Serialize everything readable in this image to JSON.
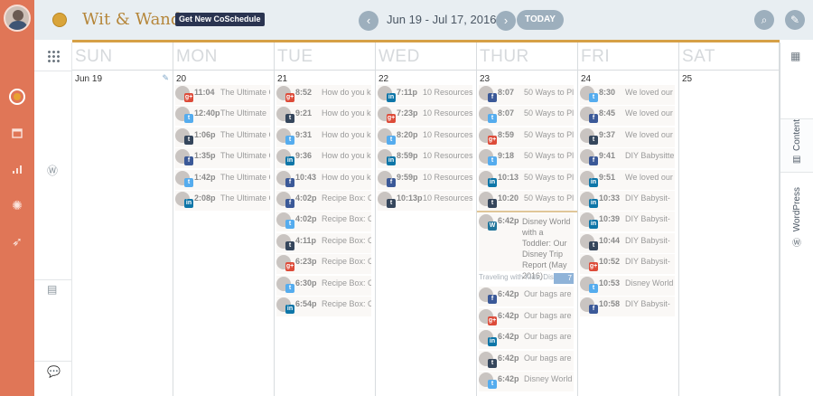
{
  "app": {
    "title": "Wit & Wander",
    "promo": "Get New CoSchedule",
    "range": "Jun 19 - Jul 17, 2016 ▾",
    "today": "TODAY"
  },
  "colors": {
    "rail": "#e07657",
    "accent": "#d6a046",
    "header_bg": "#e8eef2",
    "twitter": "#55acee",
    "facebook": "#3b5998",
    "linkedin": "#0e76a8",
    "googleplus": "#dd4b39",
    "tumblr": "#35465c",
    "wordpress": "#21759b"
  },
  "rail": {
    "icons": [
      "avatar",
      "circle-icon",
      "calendar-icon",
      "bar-chart-icon",
      "gear-icon",
      "rocket-icon"
    ]
  },
  "right_panel": {
    "tabs": [
      {
        "label": "Content",
        "icon": "document-icon"
      },
      {
        "label": "WordPress",
        "icon": "wordpress-icon"
      }
    ]
  },
  "days": [
    {
      "name": "SUN",
      "date": "Jun 19",
      "events": []
    },
    {
      "name": "MON",
      "date": "20",
      "events": [
        {
          "time": "11:04",
          "text": "The Ultimate G",
          "net": "googleplus"
        },
        {
          "time": "12:40p",
          "text": "The Ultimate",
          "net": "twitter"
        },
        {
          "time": "1:06p",
          "text": "The Ultimate G",
          "net": "tumblr"
        },
        {
          "time": "1:35p",
          "text": "The Ultimate G",
          "net": "facebook"
        },
        {
          "time": "1:42p",
          "text": "The Ultimate G",
          "net": "twitter"
        },
        {
          "time": "2:08p",
          "text": "The Ultimate G",
          "net": "linkedin"
        }
      ]
    },
    {
      "name": "TUE",
      "date": "21",
      "events": [
        {
          "time": "8:52",
          "text": "How do you kee",
          "net": "googleplus"
        },
        {
          "time": "9:21",
          "text": "How do you kee",
          "net": "tumblr"
        },
        {
          "time": "9:31",
          "text": "How do you kee",
          "net": "twitter"
        },
        {
          "time": "9:36",
          "text": "How do you kee",
          "net": "linkedin"
        },
        {
          "time": "10:43",
          "text": "How do you ke",
          "net": "facebook"
        },
        {
          "time": "4:02p",
          "text": "Recipe Box: Cr",
          "net": "facebook"
        },
        {
          "time": "4:02p",
          "text": "Recipe Box: Cr",
          "net": "twitter"
        },
        {
          "time": "4:11p",
          "text": "Recipe Box: Cr",
          "net": "tumblr"
        },
        {
          "time": "6:23p",
          "text": "Recipe Box: Cr",
          "net": "googleplus"
        },
        {
          "time": "6:30p",
          "text": "Recipe Box: Cr",
          "net": "twitter"
        },
        {
          "time": "6:54p",
          "text": "Recipe Box: Cr",
          "net": "linkedin"
        }
      ]
    },
    {
      "name": "WED",
      "date": "22",
      "events": [
        {
          "time": "7:11p",
          "text": "10 Resources t",
          "net": "linkedin"
        },
        {
          "time": "7:23p",
          "text": "10 Resources t",
          "net": "googleplus"
        },
        {
          "time": "8:20p",
          "text": "10 Resources t",
          "net": "twitter"
        },
        {
          "time": "8:59p",
          "text": "10 Resources t",
          "net": "linkedin"
        },
        {
          "time": "9:59p",
          "text": "10 Resources t",
          "net": "facebook"
        },
        {
          "time": "10:13p",
          "text": "10 Resources",
          "net": "tumblr"
        }
      ]
    },
    {
      "name": "THUR",
      "date": "23",
      "events": [
        {
          "time": "8:07",
          "text": "50 Ways to Play",
          "net": "facebook"
        },
        {
          "time": "8:07",
          "text": "50 Ways to Play",
          "net": "twitter"
        },
        {
          "time": "8:59",
          "text": "50 Ways to Play",
          "net": "googleplus"
        },
        {
          "time": "9:18",
          "text": "50 Ways to Play",
          "net": "twitter"
        },
        {
          "time": "10:13",
          "text": "50 Ways to Pla",
          "net": "linkedin"
        },
        {
          "time": "10:20",
          "text": "50 Ways to Pla",
          "net": "tumblr"
        }
      ],
      "blog": {
        "time": "6:42p",
        "text": "Disney World with a Toddler: Our Disney Trip Report (May 2016)",
        "net": "wordpress"
      },
      "campaign": {
        "label": "Traveling with Kids, Dis",
        "count": "7"
      },
      "after": [
        {
          "time": "6:42p",
          "text": "Our bags are u",
          "net": "facebook"
        },
        {
          "time": "6:42p",
          "text": "Our bags are u",
          "net": "googleplus"
        },
        {
          "time": "6:42p",
          "text": "Our bags are u",
          "net": "linkedin"
        },
        {
          "time": "6:42p",
          "text": "Our bags are u",
          "net": "tumblr"
        },
        {
          "time": "6:42p",
          "text": "Disney World w",
          "net": "twitter"
        }
      ]
    },
    {
      "name": "FRI",
      "date": "24",
      "events": [
        {
          "time": "8:30",
          "text": "We loved our W",
          "net": "twitter"
        },
        {
          "time": "8:45",
          "text": "We loved our W",
          "net": "facebook"
        },
        {
          "time": "9:37",
          "text": "We loved our W",
          "net": "tumblr"
        },
        {
          "time": "9:41",
          "text": "DIY Babysitter's",
          "net": "facebook"
        },
        {
          "time": "9:51",
          "text": "We loved our W",
          "net": "linkedin"
        },
        {
          "time": "10:33",
          "text": "DIY Babysit-",
          "net": "linkedin"
        },
        {
          "time": "10:39",
          "text": "DIY Babysit-",
          "net": "linkedin"
        },
        {
          "time": "10:44",
          "text": "DIY Babysit-",
          "net": "tumblr"
        },
        {
          "time": "10:52",
          "text": "DIY Babysit-",
          "net": "googleplus"
        },
        {
          "time": "10:53",
          "text": "Disney World w",
          "net": "twitter"
        },
        {
          "time": "10:58",
          "text": "DIY Babysit-",
          "net": "facebook"
        }
      ]
    },
    {
      "name": "SAT",
      "date": "25",
      "events": []
    }
  ]
}
